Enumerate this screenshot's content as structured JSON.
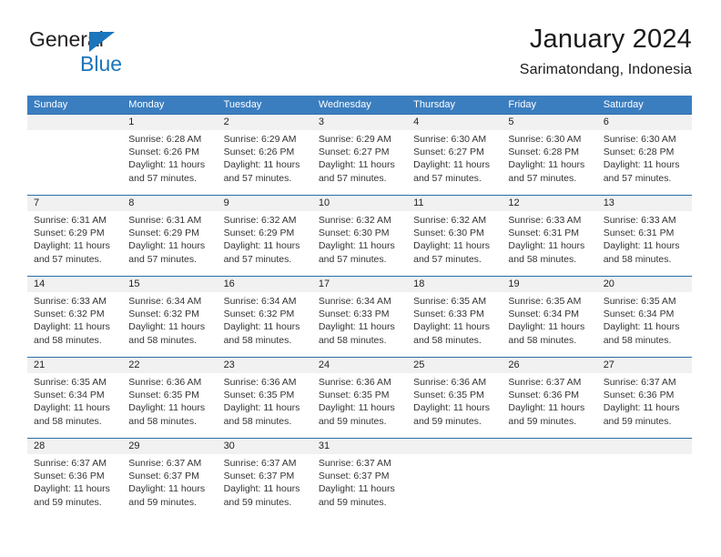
{
  "logo": {
    "name_part1": "General",
    "name_part2": "Blue",
    "icon": "triangle-mark"
  },
  "header": {
    "month_title": "January 2024",
    "location": "Sarimatondang, Indonesia"
  },
  "colors": {
    "header_blue": "#3b7ec0",
    "separator_blue": "#2d6ca8",
    "daynum_band": "#f1f1f1",
    "logo_blue": "#1b75bb"
  },
  "calendar": {
    "weekdays": [
      "Sunday",
      "Monday",
      "Tuesday",
      "Wednesday",
      "Thursday",
      "Friday",
      "Saturday"
    ],
    "weeks": [
      {
        "days": [
          {
            "num": "",
            "sunrise": "",
            "sunset": "",
            "daylight1": "",
            "daylight2": ""
          },
          {
            "num": "1",
            "sunrise": "Sunrise: 6:28 AM",
            "sunset": "Sunset: 6:26 PM",
            "daylight1": "Daylight: 11 hours",
            "daylight2": "and 57 minutes."
          },
          {
            "num": "2",
            "sunrise": "Sunrise: 6:29 AM",
            "sunset": "Sunset: 6:26 PM",
            "daylight1": "Daylight: 11 hours",
            "daylight2": "and 57 minutes."
          },
          {
            "num": "3",
            "sunrise": "Sunrise: 6:29 AM",
            "sunset": "Sunset: 6:27 PM",
            "daylight1": "Daylight: 11 hours",
            "daylight2": "and 57 minutes."
          },
          {
            "num": "4",
            "sunrise": "Sunrise: 6:30 AM",
            "sunset": "Sunset: 6:27 PM",
            "daylight1": "Daylight: 11 hours",
            "daylight2": "and 57 minutes."
          },
          {
            "num": "5",
            "sunrise": "Sunrise: 6:30 AM",
            "sunset": "Sunset: 6:28 PM",
            "daylight1": "Daylight: 11 hours",
            "daylight2": "and 57 minutes."
          },
          {
            "num": "6",
            "sunrise": "Sunrise: 6:30 AM",
            "sunset": "Sunset: 6:28 PM",
            "daylight1": "Daylight: 11 hours",
            "daylight2": "and 57 minutes."
          }
        ]
      },
      {
        "days": [
          {
            "num": "7",
            "sunrise": "Sunrise: 6:31 AM",
            "sunset": "Sunset: 6:29 PM",
            "daylight1": "Daylight: 11 hours",
            "daylight2": "and 57 minutes."
          },
          {
            "num": "8",
            "sunrise": "Sunrise: 6:31 AM",
            "sunset": "Sunset: 6:29 PM",
            "daylight1": "Daylight: 11 hours",
            "daylight2": "and 57 minutes."
          },
          {
            "num": "9",
            "sunrise": "Sunrise: 6:32 AM",
            "sunset": "Sunset: 6:29 PM",
            "daylight1": "Daylight: 11 hours",
            "daylight2": "and 57 minutes."
          },
          {
            "num": "10",
            "sunrise": "Sunrise: 6:32 AM",
            "sunset": "Sunset: 6:30 PM",
            "daylight1": "Daylight: 11 hours",
            "daylight2": "and 57 minutes."
          },
          {
            "num": "11",
            "sunrise": "Sunrise: 6:32 AM",
            "sunset": "Sunset: 6:30 PM",
            "daylight1": "Daylight: 11 hours",
            "daylight2": "and 57 minutes."
          },
          {
            "num": "12",
            "sunrise": "Sunrise: 6:33 AM",
            "sunset": "Sunset: 6:31 PM",
            "daylight1": "Daylight: 11 hours",
            "daylight2": "and 58 minutes."
          },
          {
            "num": "13",
            "sunrise": "Sunrise: 6:33 AM",
            "sunset": "Sunset: 6:31 PM",
            "daylight1": "Daylight: 11 hours",
            "daylight2": "and 58 minutes."
          }
        ]
      },
      {
        "days": [
          {
            "num": "14",
            "sunrise": "Sunrise: 6:33 AM",
            "sunset": "Sunset: 6:32 PM",
            "daylight1": "Daylight: 11 hours",
            "daylight2": "and 58 minutes."
          },
          {
            "num": "15",
            "sunrise": "Sunrise: 6:34 AM",
            "sunset": "Sunset: 6:32 PM",
            "daylight1": "Daylight: 11 hours",
            "daylight2": "and 58 minutes."
          },
          {
            "num": "16",
            "sunrise": "Sunrise: 6:34 AM",
            "sunset": "Sunset: 6:32 PM",
            "daylight1": "Daylight: 11 hours",
            "daylight2": "and 58 minutes."
          },
          {
            "num": "17",
            "sunrise": "Sunrise: 6:34 AM",
            "sunset": "Sunset: 6:33 PM",
            "daylight1": "Daylight: 11 hours",
            "daylight2": "and 58 minutes."
          },
          {
            "num": "18",
            "sunrise": "Sunrise: 6:35 AM",
            "sunset": "Sunset: 6:33 PM",
            "daylight1": "Daylight: 11 hours",
            "daylight2": "and 58 minutes."
          },
          {
            "num": "19",
            "sunrise": "Sunrise: 6:35 AM",
            "sunset": "Sunset: 6:34 PM",
            "daylight1": "Daylight: 11 hours",
            "daylight2": "and 58 minutes."
          },
          {
            "num": "20",
            "sunrise": "Sunrise: 6:35 AM",
            "sunset": "Sunset: 6:34 PM",
            "daylight1": "Daylight: 11 hours",
            "daylight2": "and 58 minutes."
          }
        ]
      },
      {
        "days": [
          {
            "num": "21",
            "sunrise": "Sunrise: 6:35 AM",
            "sunset": "Sunset: 6:34 PM",
            "daylight1": "Daylight: 11 hours",
            "daylight2": "and 58 minutes."
          },
          {
            "num": "22",
            "sunrise": "Sunrise: 6:36 AM",
            "sunset": "Sunset: 6:35 PM",
            "daylight1": "Daylight: 11 hours",
            "daylight2": "and 58 minutes."
          },
          {
            "num": "23",
            "sunrise": "Sunrise: 6:36 AM",
            "sunset": "Sunset: 6:35 PM",
            "daylight1": "Daylight: 11 hours",
            "daylight2": "and 58 minutes."
          },
          {
            "num": "24",
            "sunrise": "Sunrise: 6:36 AM",
            "sunset": "Sunset: 6:35 PM",
            "daylight1": "Daylight: 11 hours",
            "daylight2": "and 59 minutes."
          },
          {
            "num": "25",
            "sunrise": "Sunrise: 6:36 AM",
            "sunset": "Sunset: 6:35 PM",
            "daylight1": "Daylight: 11 hours",
            "daylight2": "and 59 minutes."
          },
          {
            "num": "26",
            "sunrise": "Sunrise: 6:37 AM",
            "sunset": "Sunset: 6:36 PM",
            "daylight1": "Daylight: 11 hours",
            "daylight2": "and 59 minutes."
          },
          {
            "num": "27",
            "sunrise": "Sunrise: 6:37 AM",
            "sunset": "Sunset: 6:36 PM",
            "daylight1": "Daylight: 11 hours",
            "daylight2": "and 59 minutes."
          }
        ]
      },
      {
        "days": [
          {
            "num": "28",
            "sunrise": "Sunrise: 6:37 AM",
            "sunset": "Sunset: 6:36 PM",
            "daylight1": "Daylight: 11 hours",
            "daylight2": "and 59 minutes."
          },
          {
            "num": "29",
            "sunrise": "Sunrise: 6:37 AM",
            "sunset": "Sunset: 6:37 PM",
            "daylight1": "Daylight: 11 hours",
            "daylight2": "and 59 minutes."
          },
          {
            "num": "30",
            "sunrise": "Sunrise: 6:37 AM",
            "sunset": "Sunset: 6:37 PM",
            "daylight1": "Daylight: 11 hours",
            "daylight2": "and 59 minutes."
          },
          {
            "num": "31",
            "sunrise": "Sunrise: 6:37 AM",
            "sunset": "Sunset: 6:37 PM",
            "daylight1": "Daylight: 11 hours",
            "daylight2": "and 59 minutes."
          },
          {
            "num": "",
            "sunrise": "",
            "sunset": "",
            "daylight1": "",
            "daylight2": ""
          },
          {
            "num": "",
            "sunrise": "",
            "sunset": "",
            "daylight1": "",
            "daylight2": ""
          },
          {
            "num": "",
            "sunrise": "",
            "sunset": "",
            "daylight1": "",
            "daylight2": ""
          }
        ]
      }
    ]
  }
}
